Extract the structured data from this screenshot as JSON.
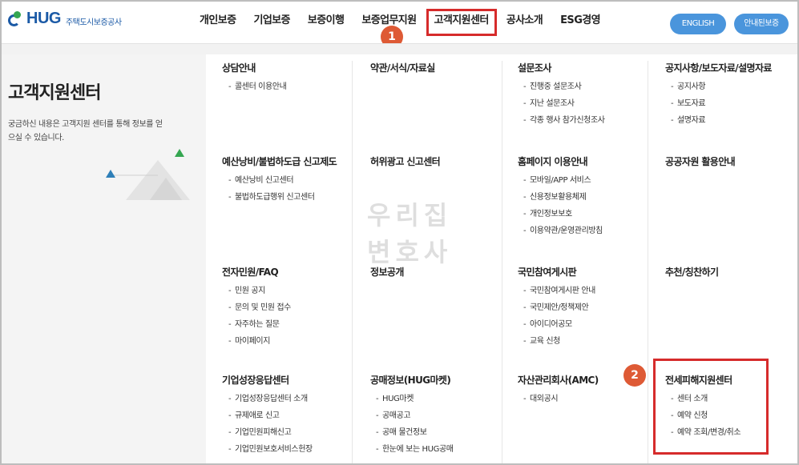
{
  "header": {
    "logo_text": "HUG",
    "logo_sub": "주택도시보증공사",
    "nav": [
      {
        "label": "개인보증"
      },
      {
        "label": "기업보증"
      },
      {
        "label": "보증이행"
      },
      {
        "label": "보증업무지원"
      },
      {
        "label": "고객지원센터"
      },
      {
        "label": "공사소개"
      },
      {
        "label": "ESG경영"
      }
    ],
    "btn_english": "ENGLISH",
    "btn_guide": "안내된보증",
    "badge1": "1",
    "badge2": "2"
  },
  "left": {
    "title": "고객지원센터",
    "desc": "궁금하신 내용은 고객지원 센터를 통해 정보를 얻으실 수 있습니다."
  },
  "watermark": {
    "line1": "우리집",
    "line2": "변호사"
  },
  "menu": {
    "r1c1": {
      "head": "상담안내",
      "items": [
        "콜센터 이용안내"
      ]
    },
    "r1c2": {
      "head": "약관/서식/자료실",
      "items": []
    },
    "r1c3": {
      "head": "설문조사",
      "items": [
        "진행중 설문조사",
        "지난 설문조사",
        "각종 행사 참가신청조사"
      ]
    },
    "r1c4": {
      "head": "공지사항/보도자료/설명자료",
      "items": [
        "공지사항",
        "보도자료",
        "설명자료"
      ]
    },
    "r2c1": {
      "head": "예산낭비/불법하도급 신고제도",
      "items": [
        "예산낭비 신고센터",
        "불법하도급행위 신고센터"
      ]
    },
    "r2c2": {
      "head": "허위광고 신고센터",
      "items": []
    },
    "r2c3": {
      "head": "홈페이지 이용안내",
      "items": [
        "모바일/APP 서비스",
        "신용정보활용체제",
        "개인정보보호",
        "이용약관/운영관리방침"
      ]
    },
    "r2c4": {
      "head": "공공자원 활용안내",
      "items": []
    },
    "r3c1": {
      "head": "전자민원/FAQ",
      "items": [
        "민원 공지",
        "문의 및 민원 접수",
        "자주하는 질문",
        "마이페이지"
      ]
    },
    "r3c2": {
      "head": "정보공개",
      "items": []
    },
    "r3c3": {
      "head": "국민참여게시판",
      "items": [
        "국민참여게시판 안내",
        "국민제안/정책제안",
        "아이디어공모",
        "교육 신청"
      ]
    },
    "r3c4": {
      "head": "추천/칭찬하기",
      "items": []
    },
    "r4c1": {
      "head": "기업성장응답센터",
      "items": [
        "기업성장응답센터 소개",
        "규제애로 신고",
        "기업민원피해신고",
        "기업민원보호서비스헌장"
      ]
    },
    "r4c2": {
      "head": "공매정보(HUG마켓)",
      "items": [
        "HUG마켓",
        "공매공고",
        "공매 물건정보",
        "한눈에 보는 HUG공매"
      ]
    },
    "r4c3": {
      "head": "자산관리회사(AMC)",
      "items": [
        "대외공시"
      ]
    },
    "r4c4": {
      "head": "전세피해지원센터",
      "items": [
        "센터 소개",
        "예약 신청",
        "예약 조회/변경/취소"
      ]
    }
  },
  "colors": {
    "accent": "#4a95dc",
    "highlight": "#d62b2b",
    "badge": "#de5a35",
    "brand": "#1b5aa6"
  }
}
